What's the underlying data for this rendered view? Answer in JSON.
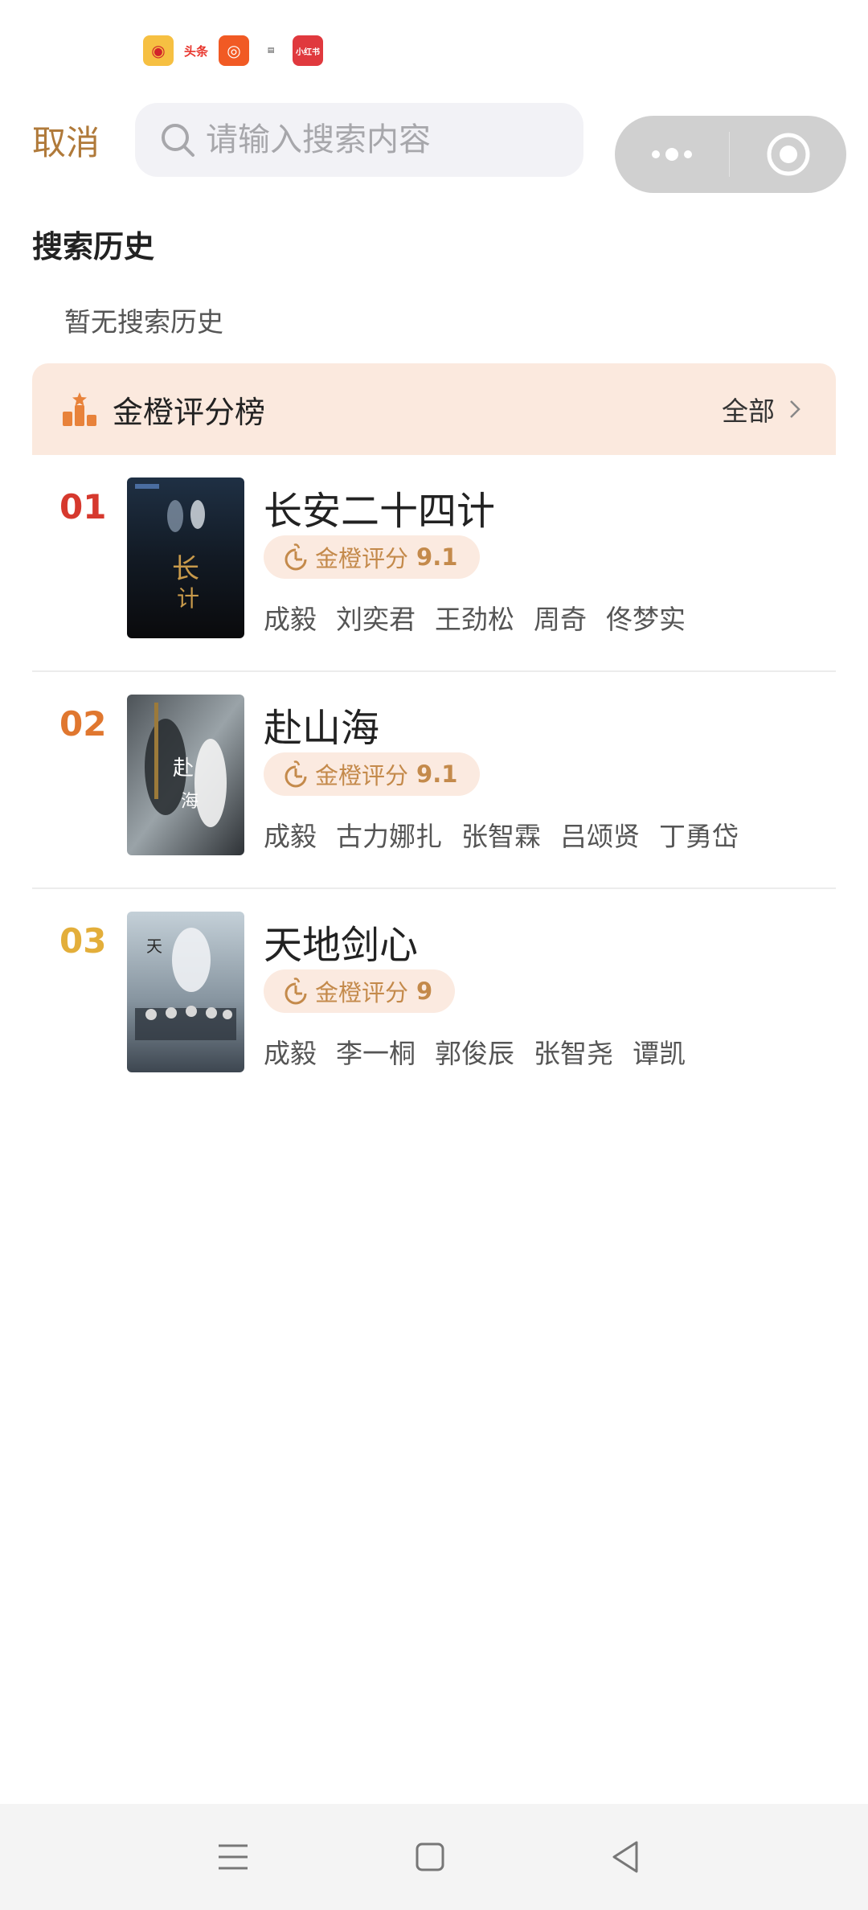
{
  "status_bar": {
    "apps": [
      {
        "name": "weibo-icon",
        "label": ""
      },
      {
        "name": "toutiao-icon",
        "label": "头条"
      },
      {
        "name": "kuaishou-icon",
        "label": ""
      },
      {
        "name": "souhu-icon",
        "label": ""
      },
      {
        "name": "xiaohongshu-icon",
        "label": "小红书"
      }
    ]
  },
  "header": {
    "cancel_label": "取消",
    "search_placeholder": "请输入搜索内容",
    "search_value": ""
  },
  "history": {
    "title": "搜索历史",
    "empty_text": "暂无搜索历史"
  },
  "ranking": {
    "title": "金橙评分榜",
    "all_label": "全部",
    "score_label": "金橙评分",
    "items": [
      {
        "rank": "01",
        "rank_color": "#d6392e",
        "title": "长安二十四计",
        "score": "9.1",
        "cast": [
          "成毅",
          "刘奕君",
          "王劲松",
          "周奇",
          "佟梦实"
        ]
      },
      {
        "rank": "02",
        "rank_color": "#e0772f",
        "title": "赴山海",
        "score": "9.1",
        "cast": [
          "成毅",
          "古力娜扎",
          "张智霖",
          "吕颂贤",
          "丁勇岱"
        ]
      },
      {
        "rank": "03",
        "rank_color": "#e3ae3a",
        "title": "天地剑心",
        "score": "9",
        "cast": [
          "成毅",
          "李一桐",
          "郭俊辰",
          "张智尧",
          "谭凯"
        ]
      }
    ]
  },
  "colors": {
    "accent": "#b07a3a",
    "score_text": "#c48a4b",
    "rank_header_bg": "#fbe9de"
  }
}
